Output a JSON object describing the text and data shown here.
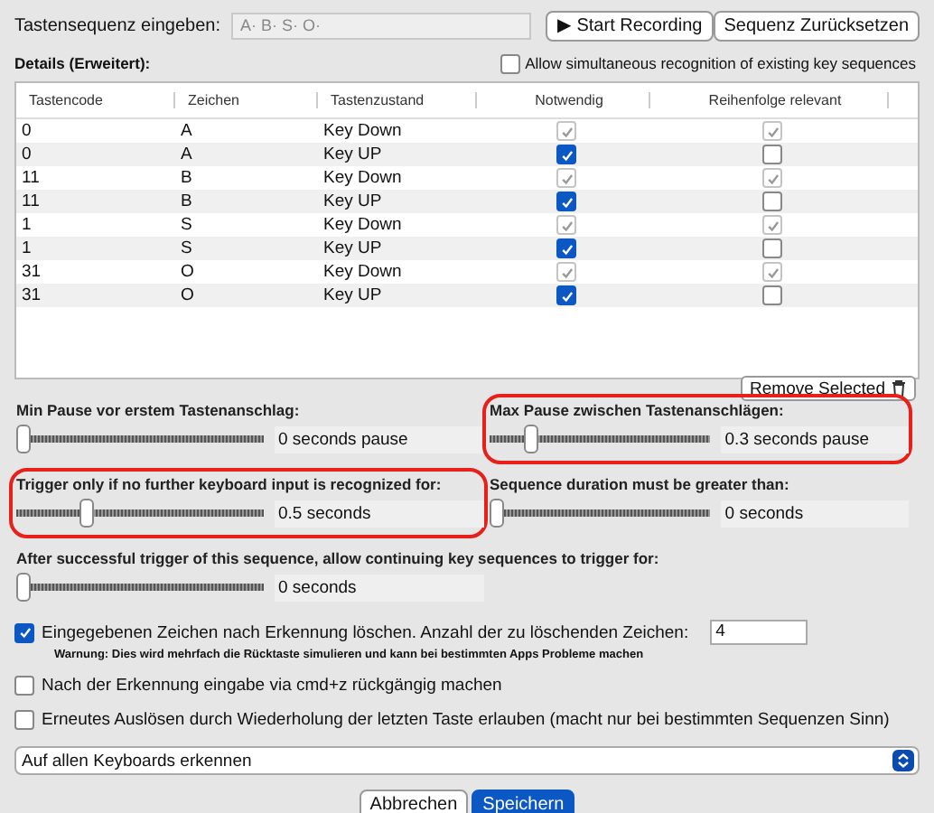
{
  "sequence": {
    "label": "Tastensequenz eingeben:",
    "value": "A· B· S· O·"
  },
  "record_button": {
    "icon": "▶",
    "label": "Start Recording"
  },
  "reset_button": "Sequenz Zurücksetzen",
  "details_label": "Details (Erweitert):",
  "simultaneous": {
    "label": "Allow simultaneous recognition of existing key sequences",
    "checked": false
  },
  "table": {
    "columns": [
      "Tastencode",
      "Zeichen",
      "Tastenzustand",
      "Notwendig",
      "Reihenfolge relevant"
    ],
    "rows": [
      {
        "code": "0",
        "char": "A",
        "state": "Key Down",
        "required": {
          "checked": true,
          "disabled": true
        },
        "order": {
          "checked": true,
          "disabled": true
        }
      },
      {
        "code": "0",
        "char": "A",
        "state": "Key UP",
        "required": {
          "checked": true,
          "disabled": false
        },
        "order": {
          "checked": false,
          "disabled": false
        }
      },
      {
        "code": "11",
        "char": "B",
        "state": "Key Down",
        "required": {
          "checked": true,
          "disabled": true
        },
        "order": {
          "checked": true,
          "disabled": true
        }
      },
      {
        "code": "11",
        "char": "B",
        "state": "Key UP",
        "required": {
          "checked": true,
          "disabled": false
        },
        "order": {
          "checked": false,
          "disabled": false
        }
      },
      {
        "code": "1",
        "char": "S",
        "state": "Key Down",
        "required": {
          "checked": true,
          "disabled": true
        },
        "order": {
          "checked": true,
          "disabled": true
        }
      },
      {
        "code": "1",
        "char": "S",
        "state": "Key UP",
        "required": {
          "checked": true,
          "disabled": false
        },
        "order": {
          "checked": false,
          "disabled": false
        }
      },
      {
        "code": "31",
        "char": "O",
        "state": "Key Down",
        "required": {
          "checked": true,
          "disabled": true
        },
        "order": {
          "checked": true,
          "disabled": true
        }
      },
      {
        "code": "31",
        "char": "O",
        "state": "Key UP",
        "required": {
          "checked": true,
          "disabled": false
        },
        "order": {
          "checked": false,
          "disabled": false
        }
      }
    ]
  },
  "remove_button": "Remove Selected",
  "sliders": [
    {
      "label": "Min Pause vor erstem Tastenanschlag:",
      "level": 0,
      "reading": "0 seconds pause",
      "highlighted": false
    },
    {
      "label": "Max Pause zwischen Tastenanschlägen:",
      "level": 0.15,
      "reading": "0.3 seconds pause",
      "highlighted": true
    },
    {
      "label": "Trigger only if no further keyboard input is recognized for:",
      "level": 0.27,
      "reading": "0.5 seconds",
      "highlighted": true
    },
    {
      "label": "Sequence duration must be greater than:",
      "level": 0,
      "reading": "0 seconds",
      "highlighted": false
    },
    {
      "label": "After successful trigger of this sequence, allow continuing key sequences to trigger for:",
      "level": 0,
      "reading": "0 seconds",
      "highlighted": false
    }
  ],
  "delete_option": {
    "label": "Eingegebenen Zeichen nach Erkennung löschen. Anzahl der zu löschenden Zeichen:",
    "checked": true,
    "count": "4",
    "warning": "Warnung: Dies wird mehrfach die Rücktaste simulieren und kann bei bestimmten Apps Probleme machen"
  },
  "options": [
    {
      "label": "Nach der Erkennung eingabe via cmd+z rückgängig machen",
      "checked": false
    },
    {
      "label": "Erneutes Auslösen durch Wiederholung der letzten Taste erlauben (macht nur bei bestimmten Sequenzen Sinn)",
      "checked": false
    }
  ],
  "keyboard_select": "Auf allen Keyboards erkennen",
  "cancel_button": "Abbrechen",
  "save_button": "Speichern"
}
